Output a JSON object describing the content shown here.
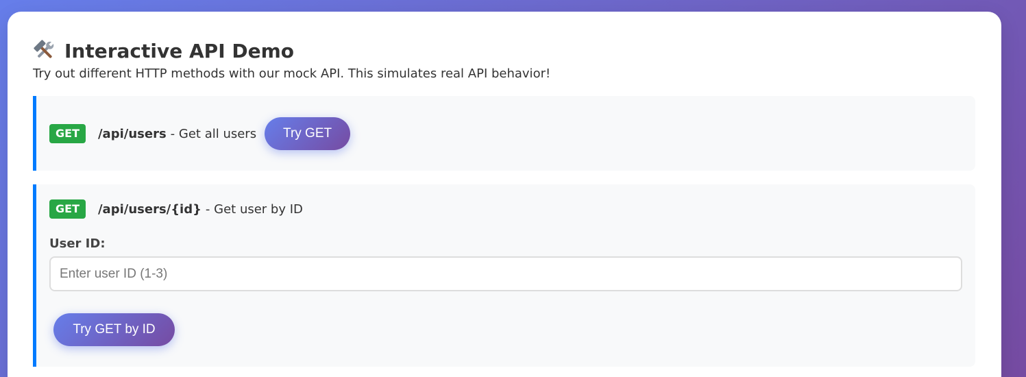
{
  "header": {
    "icon": "hammer-and-wrench-icon",
    "title": "Interactive API Demo",
    "subtitle": "Try out different HTTP methods with our mock API. This simulates real API behavior!"
  },
  "endpoints": [
    {
      "method": "GET",
      "path": "/api/users",
      "description": "- Get all users",
      "button_label": "Try GET"
    },
    {
      "method": "GET",
      "path": "/api/users/{id}",
      "description": "- Get user by ID",
      "field_label": "User ID:",
      "input_value": "",
      "input_placeholder": "Enter user ID (1-3)",
      "button_label": "Try GET by ID"
    }
  ],
  "colors": {
    "gradient_start": "#667eea",
    "gradient_end": "#764ba2",
    "get_badge": "#28a745",
    "endpoint_border": "#007bff",
    "endpoint_bg": "#f8f9fa"
  }
}
